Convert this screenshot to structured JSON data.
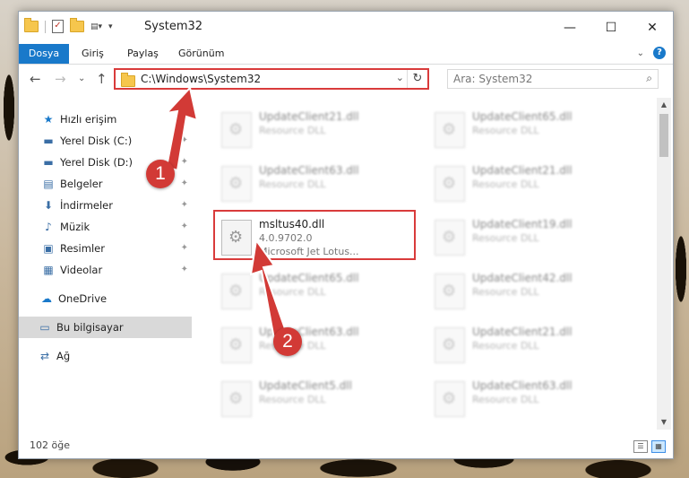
{
  "window": {
    "title": "System32",
    "controls": {
      "minimize": "—",
      "maximize": "☐",
      "close": "✕"
    }
  },
  "ribbon": {
    "tabs": [
      "Dosya",
      "Giriş",
      "Paylaş",
      "Görünüm"
    ],
    "help": "?",
    "expand": "⌄"
  },
  "nav": {
    "back": "←",
    "forward": "→",
    "recent": "⌄",
    "up": "↑",
    "address": "C:\\Windows\\System32",
    "address_dropdown": "⌄",
    "refresh": "↻",
    "search_placeholder": "Ara: System32",
    "search_icon": "⌕"
  },
  "sidebar": {
    "items": [
      {
        "label": "Hızlı erişim",
        "icon": "star-icon",
        "glyph": "★",
        "pinned": false
      },
      {
        "label": "Yerel Disk (C:)",
        "icon": "drive-icon",
        "glyph": "▬",
        "pinned": true
      },
      {
        "label": "Yerel Disk (D:)",
        "icon": "drive-icon",
        "glyph": "▬",
        "pinned": true
      },
      {
        "label": "Belgeler",
        "icon": "documents-icon",
        "glyph": "▤",
        "pinned": true
      },
      {
        "label": "İndirmeler",
        "icon": "download-icon",
        "glyph": "⬇",
        "pinned": true
      },
      {
        "label": "Müzik",
        "icon": "music-icon",
        "glyph": "♪",
        "pinned": true
      },
      {
        "label": "Resimler",
        "icon": "pictures-icon",
        "glyph": "▣",
        "pinned": true
      },
      {
        "label": "Videolar",
        "icon": "video-icon",
        "glyph": "▦",
        "pinned": true
      },
      {
        "label": "OneDrive",
        "icon": "cloud-icon",
        "glyph": "☁",
        "pinned": false
      },
      {
        "label": "Bu bilgisayar",
        "icon": "computer-icon",
        "glyph": "▭",
        "pinned": false
      },
      {
        "label": "Ağ",
        "icon": "network-icon",
        "glyph": "⇄",
        "pinned": false
      }
    ],
    "pin_glyph": "✦"
  },
  "files": {
    "left": [
      {
        "name": "UpdateClient21.dll",
        "desc": "Resource DLL"
      },
      {
        "name": "UpdateClient63.dll",
        "desc": "Resource DLL"
      },
      {
        "name": "msltus40.dll",
        "version": "4.0.9702.0",
        "desc": "Microsoft Jet Lotus..."
      },
      {
        "name": "UpdateClient65.dll",
        "desc": "Resource DLL"
      },
      {
        "name": "UpdateClient63.dll",
        "desc": "Resource DLL"
      },
      {
        "name": "UpdateClient5.dll",
        "desc": "Resource DLL"
      }
    ],
    "right": [
      {
        "name": "UpdateClient65.dll",
        "desc": "Resource DLL"
      },
      {
        "name": "UpdateClient21.dll",
        "desc": "Resource DLL"
      },
      {
        "name": "UpdateClient19.dll",
        "desc": "Resource DLL"
      },
      {
        "name": "UpdateClient42.dll",
        "desc": "Resource DLL"
      },
      {
        "name": "UpdateClient21.dll",
        "desc": "Resource DLL"
      },
      {
        "name": "UpdateClient63.dll",
        "desc": "Resource DLL"
      }
    ]
  },
  "status": {
    "count": "102 öğe"
  },
  "annotations": {
    "step1": "1",
    "step2": "2"
  },
  "colors": {
    "accent": "#1979ca",
    "highlight": "#d93b3b",
    "badge": "#d23a36"
  }
}
